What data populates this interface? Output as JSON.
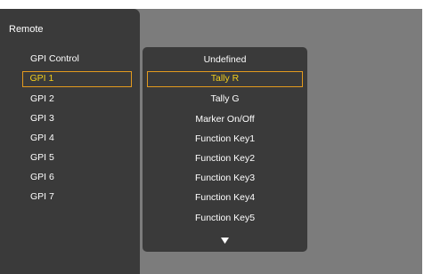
{
  "sidebar": {
    "title": "Remote",
    "items": [
      {
        "label": "GPI Control",
        "selected": false
      },
      {
        "label": "GPI 1",
        "selected": true
      },
      {
        "label": "GPI 2",
        "selected": false
      },
      {
        "label": "GPI 3",
        "selected": false
      },
      {
        "label": "GPI 4",
        "selected": false
      },
      {
        "label": "GPI 5",
        "selected": false
      },
      {
        "label": "GPI 6",
        "selected": false
      },
      {
        "label": "GPI 7",
        "selected": false
      }
    ]
  },
  "dropdown": {
    "options": [
      {
        "label": "Undefined",
        "selected": false
      },
      {
        "label": "Tally R",
        "selected": true
      },
      {
        "label": "Tally G",
        "selected": false
      },
      {
        "label": "Marker On/Off",
        "selected": false
      },
      {
        "label": "Function Key1",
        "selected": false
      },
      {
        "label": "Function Key2",
        "selected": false
      },
      {
        "label": "Function Key3",
        "selected": false
      },
      {
        "label": "Function Key4",
        "selected": false
      },
      {
        "label": "Function Key5",
        "selected": false
      }
    ],
    "more_icon": "scroll-down-arrow"
  },
  "colors": {
    "background": "#7c7c7c",
    "panel": "#3a3a3a",
    "text": "#ffffff",
    "selected_text": "#f2ce1c",
    "selected_border": "#e39a1e"
  }
}
